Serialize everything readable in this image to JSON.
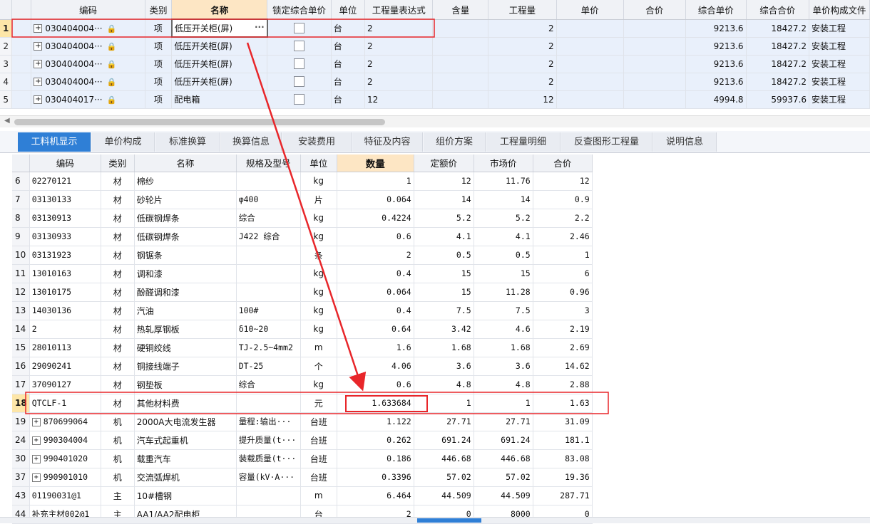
{
  "top_table": {
    "headers": [
      "编码",
      "类别",
      "名称",
      "锁定综合单价",
      "单位",
      "工程量表达式",
      "含量",
      "工程量",
      "单价",
      "合价",
      "综合单价",
      "综合合价",
      "单价构成文件"
    ],
    "rows": [
      {
        "no": "1",
        "code": "030404004···",
        "type": "项",
        "name": "低压开关柜(屏)",
        "unit": "台",
        "expr": "2",
        "qty": "2",
        "comp_price": "9213.6",
        "comp_total": "18427.2",
        "file": "安装工程",
        "expand": "+",
        "more": "···"
      },
      {
        "no": "2",
        "code": "030404004···",
        "type": "项",
        "name": "低压开关柜(屏)",
        "unit": "台",
        "expr": "2",
        "qty": "2",
        "comp_price": "9213.6",
        "comp_total": "18427.2",
        "file": "安装工程",
        "expand": "+"
      },
      {
        "no": "3",
        "code": "030404004···",
        "type": "项",
        "name": "低压开关柜(屏)",
        "unit": "台",
        "expr": "2",
        "qty": "2",
        "comp_price": "9213.6",
        "comp_total": "18427.2",
        "file": "安装工程",
        "expand": "+"
      },
      {
        "no": "4",
        "code": "030404004···",
        "type": "项",
        "name": "低压开关柜(屏)",
        "unit": "台",
        "expr": "2",
        "qty": "2",
        "comp_price": "9213.6",
        "comp_total": "18427.2",
        "file": "安装工程",
        "expand": "+"
      },
      {
        "no": "5",
        "code": "030404017···",
        "type": "项",
        "name": "配电箱",
        "unit": "台",
        "expr": "12",
        "qty": "12",
        "comp_price": "4994.8",
        "comp_total": "59937.6",
        "file": "安装工程",
        "expand": "+"
      }
    ]
  },
  "tabs": [
    "工料机显示",
    "单价构成",
    "标准换算",
    "换算信息",
    "安装费用",
    "特征及内容",
    "组价方案",
    "工程量明细",
    "反查图形工程量",
    "说明信息"
  ],
  "bottom_table": {
    "headers": [
      "编码",
      "类别",
      "名称",
      "规格及型号",
      "单位",
      "数量",
      "定额价",
      "市场价",
      "合价"
    ],
    "rows": [
      {
        "no": "6",
        "code": "02270121",
        "type": "材",
        "name": "棉纱",
        "spec": "",
        "unit": "kg",
        "qty": "1",
        "quota": "12",
        "market": "11.76",
        "total": "12"
      },
      {
        "no": "7",
        "code": "03130133",
        "type": "材",
        "name": "砂轮片",
        "spec": "φ400",
        "unit": "片",
        "qty": "0.064",
        "quota": "14",
        "market": "14",
        "total": "0.9"
      },
      {
        "no": "8",
        "code": "03130913",
        "type": "材",
        "name": "低碳钢焊条",
        "spec": "综合",
        "unit": "kg",
        "qty": "0.4224",
        "quota": "5.2",
        "market": "5.2",
        "total": "2.2"
      },
      {
        "no": "9",
        "code": "03130933",
        "type": "材",
        "name": "低碳钢焊条",
        "spec": "J422 综合",
        "unit": "kg",
        "qty": "0.6",
        "quota": "4.1",
        "market": "4.1",
        "total": "2.46"
      },
      {
        "no": "10",
        "code": "03131923",
        "type": "材",
        "name": "钢锯条",
        "spec": "",
        "unit": "条",
        "qty": "2",
        "quota": "0.5",
        "market": "0.5",
        "total": "1"
      },
      {
        "no": "11",
        "code": "13010163",
        "type": "材",
        "name": "调和漆",
        "spec": "",
        "unit": "kg",
        "qty": "0.4",
        "quota": "15",
        "market": "15",
        "total": "6"
      },
      {
        "no": "12",
        "code": "13010175",
        "type": "材",
        "name": "酚醛调和漆",
        "spec": "",
        "unit": "kg",
        "qty": "0.064",
        "quota": "15",
        "market": "11.28",
        "total": "0.96"
      },
      {
        "no": "13",
        "code": "14030136",
        "type": "材",
        "name": "汽油",
        "spec": "100#",
        "unit": "kg",
        "qty": "0.4",
        "quota": "7.5",
        "market": "7.5",
        "total": "3"
      },
      {
        "no": "14",
        "code": "2",
        "type": "材",
        "name": "热轧厚钢板",
        "spec": "δ10~20",
        "unit": "kg",
        "qty": "0.64",
        "quota": "3.42",
        "market": "4.6",
        "total": "2.19"
      },
      {
        "no": "15",
        "code": "28010113",
        "type": "材",
        "name": "硬铜绞线",
        "spec": "TJ-2.5~4mm2",
        "unit": "m",
        "qty": "1.6",
        "quota": "1.68",
        "market": "1.68",
        "total": "2.69"
      },
      {
        "no": "16",
        "code": "29090241",
        "type": "材",
        "name": "铜接线端子",
        "spec": "DT-25",
        "unit": "个",
        "qty": "4.06",
        "quota": "3.6",
        "market": "3.6",
        "total": "14.62"
      },
      {
        "no": "17",
        "code": "37090127",
        "type": "材",
        "name": "钢垫板",
        "spec": "综合",
        "unit": "kg",
        "qty": "0.6",
        "quota": "4.8",
        "market": "4.8",
        "total": "2.88"
      },
      {
        "no": "18",
        "code": "QTCLF-1",
        "type": "材",
        "name": "其他材料费",
        "spec": "",
        "unit": "元",
        "qty": "1.633684",
        "quota": "1",
        "market": "1",
        "total": "1.63"
      },
      {
        "no": "19",
        "code": "870699064",
        "type": "机",
        "name": "2000A大电流发生器",
        "spec": "量程:输出···",
        "unit": "台班",
        "qty": "1.122",
        "quota": "27.71",
        "market": "27.71",
        "total": "31.09",
        "expand": "+"
      },
      {
        "no": "24",
        "code": "990304004",
        "type": "机",
        "name": "汽车式起重机",
        "spec": "提升质量(t···",
        "unit": "台班",
        "qty": "0.262",
        "quota": "691.24",
        "market": "691.24",
        "total": "181.1",
        "expand": "+"
      },
      {
        "no": "30",
        "code": "990401020",
        "type": "机",
        "name": "载重汽车",
        "spec": "装载质量(t···",
        "unit": "台班",
        "qty": "0.186",
        "quota": "446.68",
        "market": "446.68",
        "total": "83.08",
        "expand": "+"
      },
      {
        "no": "37",
        "code": "990901010",
        "type": "机",
        "name": "交流弧焊机",
        "spec": "容量(kV·A···",
        "unit": "台班",
        "qty": "0.3396",
        "quota": "57.02",
        "market": "57.02",
        "total": "19.36",
        "expand": "+"
      },
      {
        "no": "43",
        "code": "01190031@1",
        "type": "主",
        "name": "10#槽钢",
        "spec": "",
        "unit": "m",
        "qty": "6.464",
        "quota": "44.509",
        "market": "44.509",
        "total": "287.71"
      },
      {
        "no": "44",
        "code": "补充主材002@1",
        "type": "主",
        "name": "AA1/AA2配电柜",
        "spec": "",
        "unit": "台",
        "qty": "2",
        "quota": "0",
        "market": "8000",
        "total": "0"
      }
    ]
  },
  "colors": {
    "accent": "#2f7fd6",
    "highlight": "#e8262a",
    "selected_row": "#e9f0fb"
  },
  "icons": {
    "lock": "lock-icon",
    "expand": "expand-plus-icon",
    "more": "ellipsis-icon",
    "arrow": "scroll-left-arrow-icon"
  }
}
